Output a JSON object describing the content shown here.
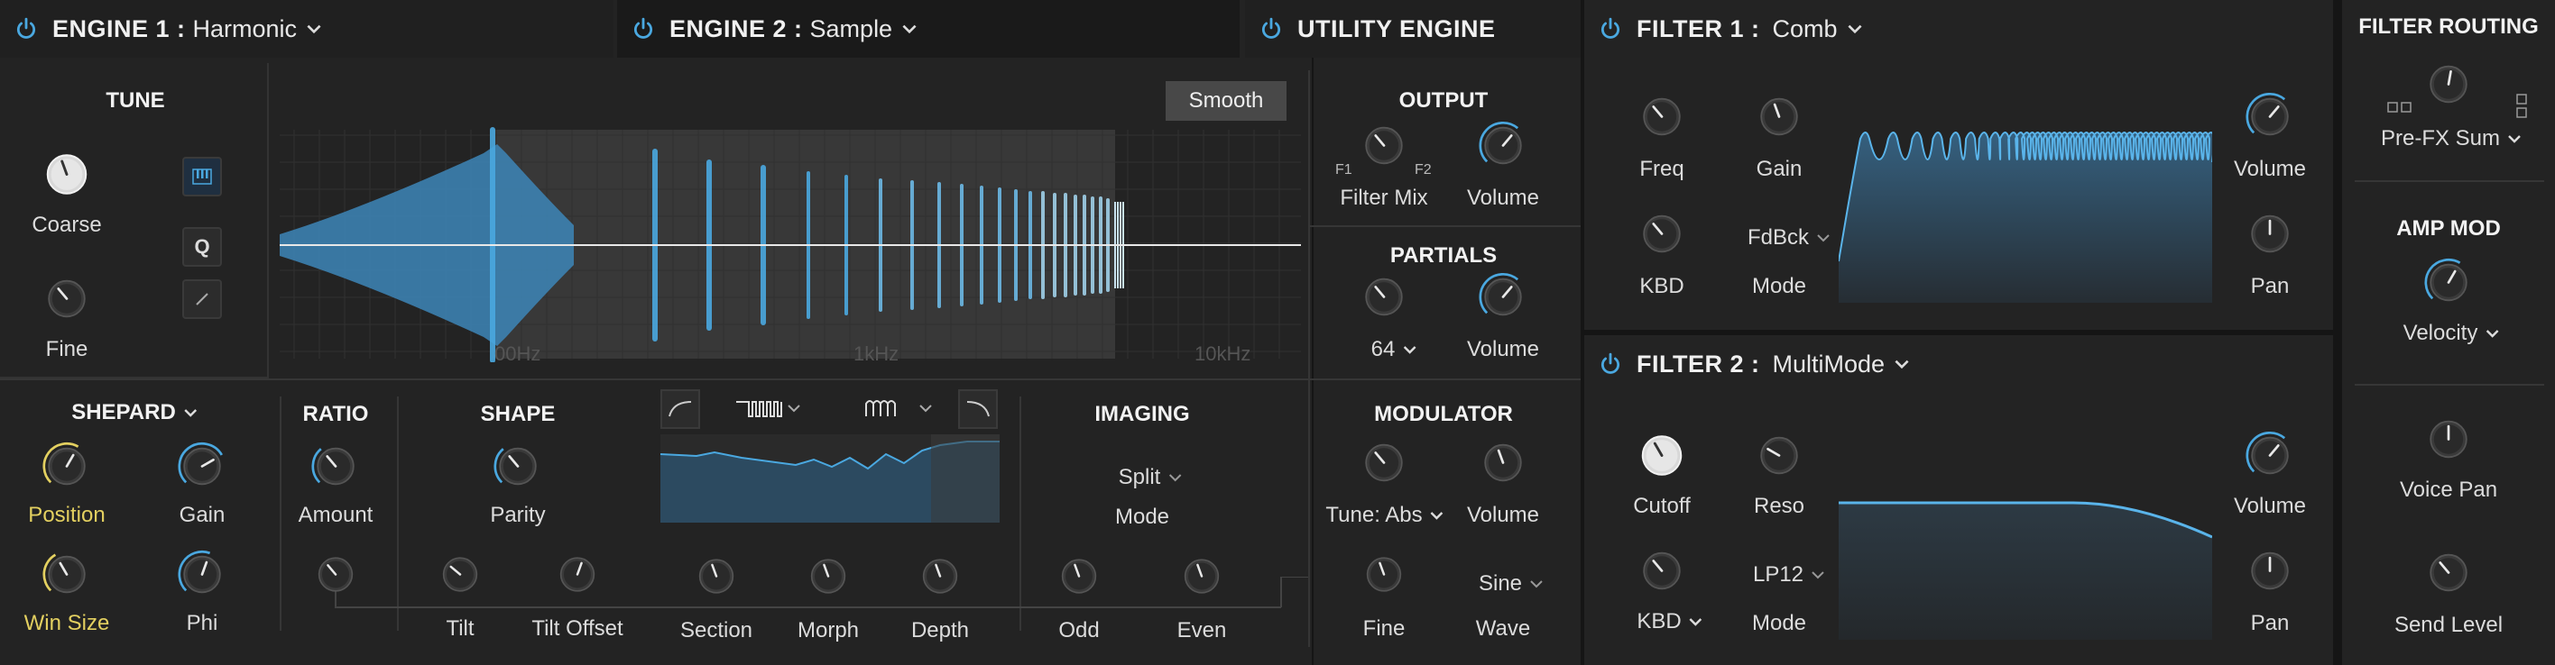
{
  "engine1": {
    "title": "ENGINE 1 :",
    "type": "Harmonic"
  },
  "engine2": {
    "title": "ENGINE 2 :",
    "type": "Sample"
  },
  "utility": {
    "title": "UTILITY ENGINE"
  },
  "tune": {
    "title": "TUNE",
    "coarse": "Coarse",
    "fine": "Fine",
    "btn_q": "Q"
  },
  "display": {
    "smooth": "Smooth",
    "freq_labels": [
      "00Hz",
      "1kHz",
      "10kHz"
    ]
  },
  "output": {
    "title": "OUTPUT",
    "f1": "F1",
    "f2": "F2",
    "filter_mix": "Filter Mix",
    "volume": "Volume"
  },
  "partials": {
    "title": "PARTIALS",
    "value": "64",
    "volume": "Volume"
  },
  "shepard": {
    "title": "SHEPARD",
    "position": "Position",
    "gain": "Gain",
    "win_size": "Win Size",
    "phi": "Phi"
  },
  "ratio": {
    "title": "RATIO",
    "amount": "Amount"
  },
  "shape": {
    "title": "SHAPE",
    "parity": "Parity",
    "tilt": "Tilt",
    "tilt_offset": "Tilt Offset",
    "section": "Section",
    "morph": "Morph",
    "depth": "Depth"
  },
  "imaging": {
    "title": "IMAGING",
    "mode_value": "Split",
    "mode": "Mode",
    "odd": "Odd",
    "even": "Even"
  },
  "modulator": {
    "title": "MODULATOR",
    "tune_value": "Tune: Abs",
    "volume": "Volume",
    "fine": "Fine",
    "wave_value": "Sine",
    "wave": "Wave"
  },
  "filter1": {
    "title": "FILTER 1 :",
    "type": "Comb",
    "freq": "Freq",
    "gain": "Gain",
    "kbd": "KBD",
    "mode_value": "FdBck",
    "mode": "Mode",
    "volume": "Volume",
    "pan": "Pan"
  },
  "filter2": {
    "title": "FILTER 2 :",
    "type": "MultiMode",
    "cutoff": "Cutoff",
    "reso": "Reso",
    "kbd": "KBD",
    "mode_value": "LP12",
    "mode": "Mode",
    "volume": "Volume",
    "pan": "Pan"
  },
  "routing": {
    "title": "FILTER ROUTING",
    "value": "Pre-FX Sum",
    "amp_mod": "AMP MOD",
    "velocity": "Velocity",
    "voice_pan": "Voice Pan",
    "send_level": "Send Level"
  },
  "colors": {
    "accent": "#4aa8e0",
    "highlight": "#e3d060",
    "panel": "#232323",
    "header": "#1a1a1a"
  }
}
